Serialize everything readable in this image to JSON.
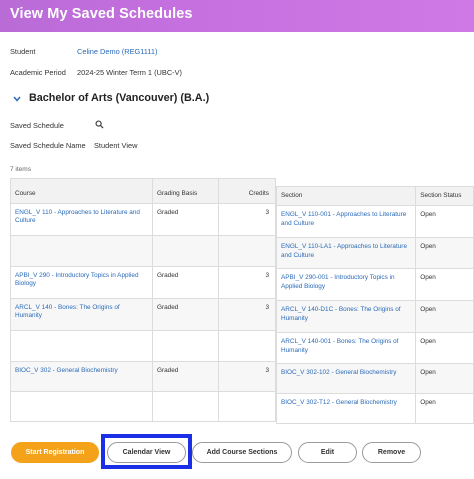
{
  "header": {
    "title": "View My Saved Schedules"
  },
  "fields": {
    "student_label": "Student",
    "student_value": "Celine Demo (REG1111)",
    "period_label": "Academic Period",
    "period_value": "2024-25 Winter Term 1 (UBC-V)"
  },
  "program": {
    "title": "Bachelor of Arts (Vancouver) (B.A.)"
  },
  "saved_schedule": {
    "label": "Saved Schedule",
    "name_label": "Saved Schedule Name",
    "name_value": "Student View"
  },
  "table": {
    "count": "7 items",
    "headers": {
      "course": "Course",
      "grading": "Grading Basis",
      "credits": "Credits",
      "section": "Section",
      "status": "Section Status"
    },
    "rows": [
      {
        "course": "ENGL_V 110 - Approaches to Literature and Culture",
        "grading": "Graded",
        "credits": "3",
        "section": "ENGL_V 110-001 - Approaches to Literature and Culture",
        "status": "Open"
      },
      {
        "course": "",
        "grading": "",
        "credits": "",
        "section": "ENGL_V 110-LA1 - Approaches to Literature and Culture",
        "status": "Open"
      },
      {
        "course": "APBI_V 290 - Introductory Topics in Applied Biology",
        "grading": "Graded",
        "credits": "3",
        "section": "APBI_V 290-001 - Introductory Topics in Applied Biology",
        "status": "Open"
      },
      {
        "course": "ARCL_V 140 - Bones: The Origins of Humanity",
        "grading": "Graded",
        "credits": "3",
        "section": "ARCL_V 140-D1C - Bones: The Origins of Humanity",
        "status": "Open"
      },
      {
        "course": "",
        "grading": "",
        "credits": "",
        "section": "ARCL_V 140-001 - Bones: The Origins of Humanity",
        "status": "Open"
      },
      {
        "course": "BIOC_V 302 - General Biochemistry",
        "grading": "Graded",
        "credits": "3",
        "section": "BIOC_V 302-102 - General Biochemistry",
        "status": "Open"
      },
      {
        "course": "",
        "grading": "",
        "credits": "",
        "section": "BIOC_V 302-T12 - General Biochemistry",
        "status": "Open"
      }
    ]
  },
  "buttons": {
    "start_registration": "Start Registration",
    "calendar_view": "Calendar View",
    "add_course_sections": "Add Course Sections",
    "edit": "Edit",
    "remove": "Remove"
  },
  "colors": {
    "header": "#c670e0",
    "link": "#2a6ab8",
    "primary_button": "#f5a21b",
    "highlight": "#1a2fe6"
  }
}
